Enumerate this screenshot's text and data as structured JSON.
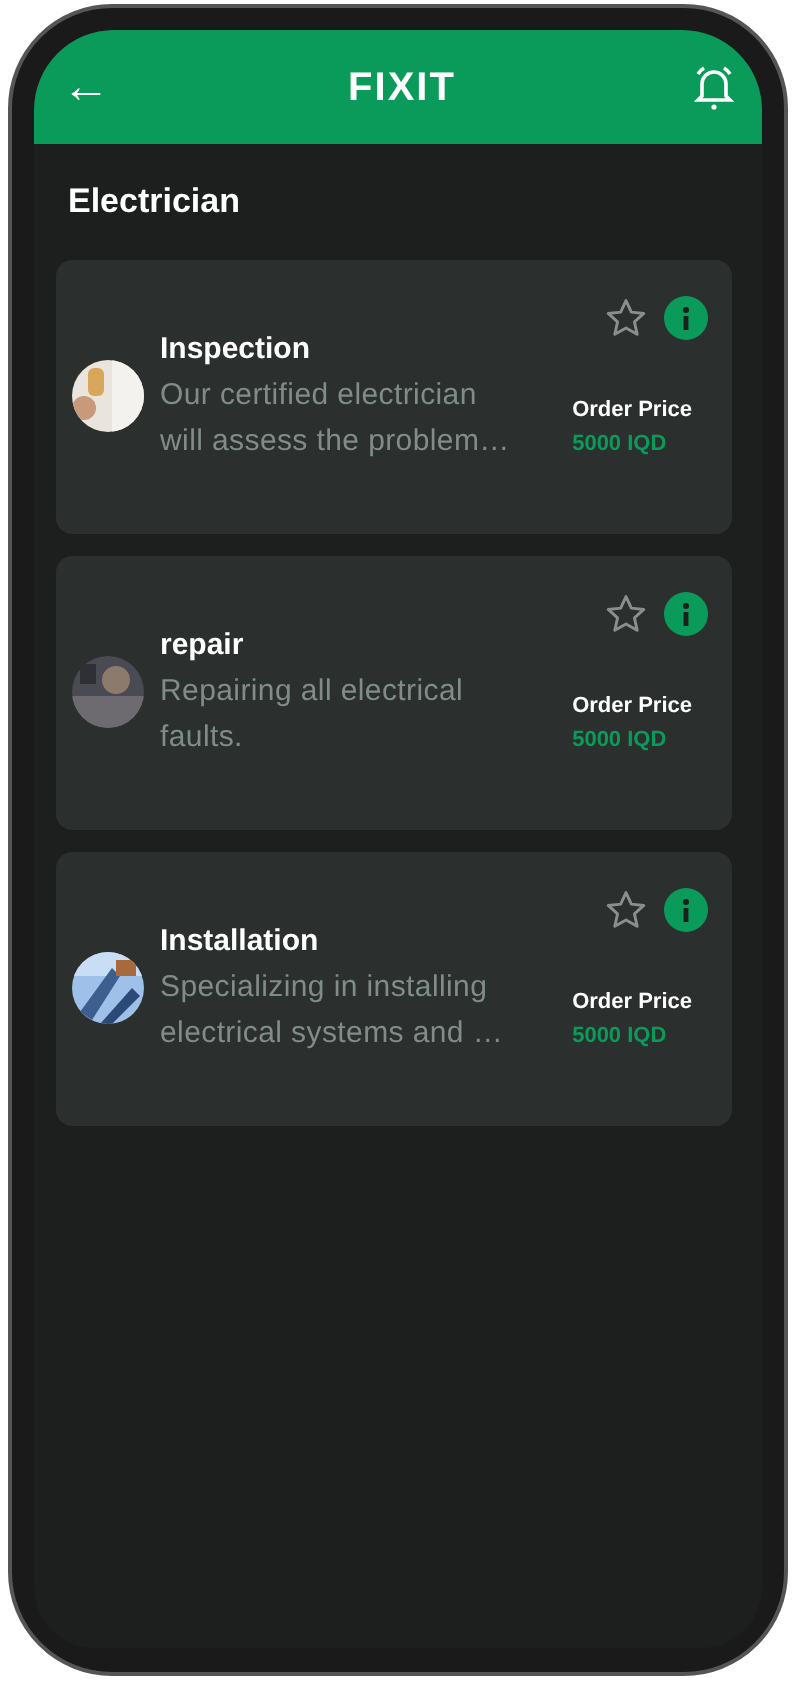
{
  "app_bar": {
    "title": "FIXIT",
    "back_icon": "←"
  },
  "page_title": "Electrician",
  "services": [
    {
      "name": "Inspection",
      "description": "Our certified electrician will assess the problem…",
      "price_label": "Order Price",
      "price": "5000 IQD",
      "favorite": false
    },
    {
      "name": "repair",
      "description": "Repairing all electrical faults.",
      "price_label": "Order Price",
      "price": "5000 IQD",
      "favorite": false
    },
    {
      "name": "Installation",
      "description": "Specializing in installing electrical systems and …",
      "price_label": "Order Price",
      "price": "5000 IQD",
      "favorite": false
    }
  ]
}
